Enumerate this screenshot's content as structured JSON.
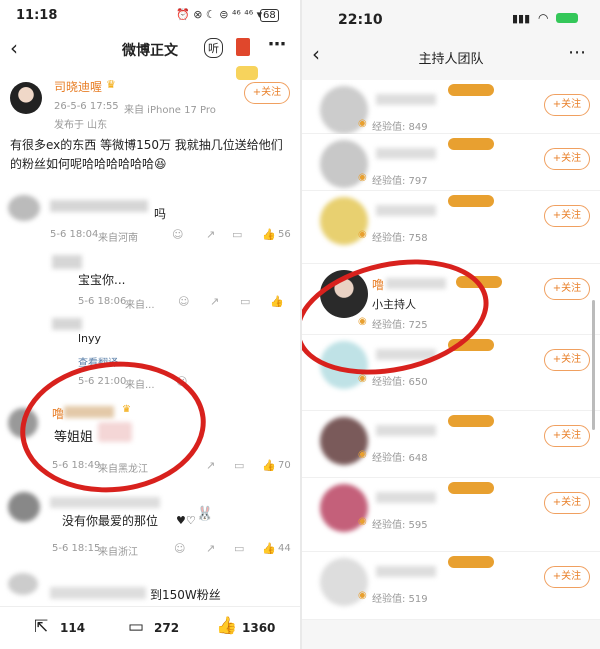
{
  "left": {
    "status": {
      "time": "11:18",
      "battery": "68"
    },
    "nav": {
      "title": "微博正文",
      "listen_label": "听"
    },
    "post": {
      "author": "司晓迪喔",
      "date": "26-5-6 17:55",
      "device": "来自 iPhone 17 Pro",
      "location": "发布于 山东",
      "follow": "+关注",
      "body_line1": "有很多ex的东西 等微博150万 我就抽几位送给他们",
      "body_line2": "的粉丝如何呢哈哈哈哈哈哈"
    },
    "comments": [
      {
        "text": "吗",
        "date": "5-6 18:04",
        "from": "来自河南",
        "likes": "56"
      },
      {
        "text": "宝宝你...",
        "date": "5-6 18:06",
        "from": "来自..."
      },
      {
        "text": "lnyy",
        "translate": "查看翻译",
        "date": "5-6 21:00",
        "from": "来自..."
      },
      {
        "name": "噜",
        "text": "等姐姐",
        "date": "5-6 18:49",
        "from": "来自黑龙江",
        "likes": "70"
      },
      {
        "text": "没有你最爱的那位",
        "date": "5-6 18:15",
        "from": "来自浙江",
        "likes": "44"
      },
      {
        "text": "到150W粉丝"
      }
    ],
    "bottom": {
      "reposts": "114",
      "comments": "272",
      "likes": "1360"
    }
  },
  "right": {
    "status": {
      "time": "22:10"
    },
    "nav": {
      "title": "主持人团队"
    },
    "members": [
      {
        "exp": "经验值: 849",
        "follow": "+关注"
      },
      {
        "exp": "经验值: 797",
        "follow": "+关注"
      },
      {
        "exp": "经验值: 758",
        "follow": "+关注"
      },
      {
        "name": "噜",
        "role": "小主持人",
        "exp": "经验值: 725",
        "follow": "+关注"
      },
      {
        "exp": "经验值: 650",
        "follow": "+关注"
      },
      {
        "exp": "经验值: 648",
        "follow": "+关注"
      },
      {
        "exp": "经验值: 595",
        "follow": "+关注"
      },
      {
        "exp": "经验值: 519",
        "follow": "+关注"
      }
    ]
  },
  "colors": {
    "accent": "#e8802a",
    "circle": "#d8211d"
  }
}
